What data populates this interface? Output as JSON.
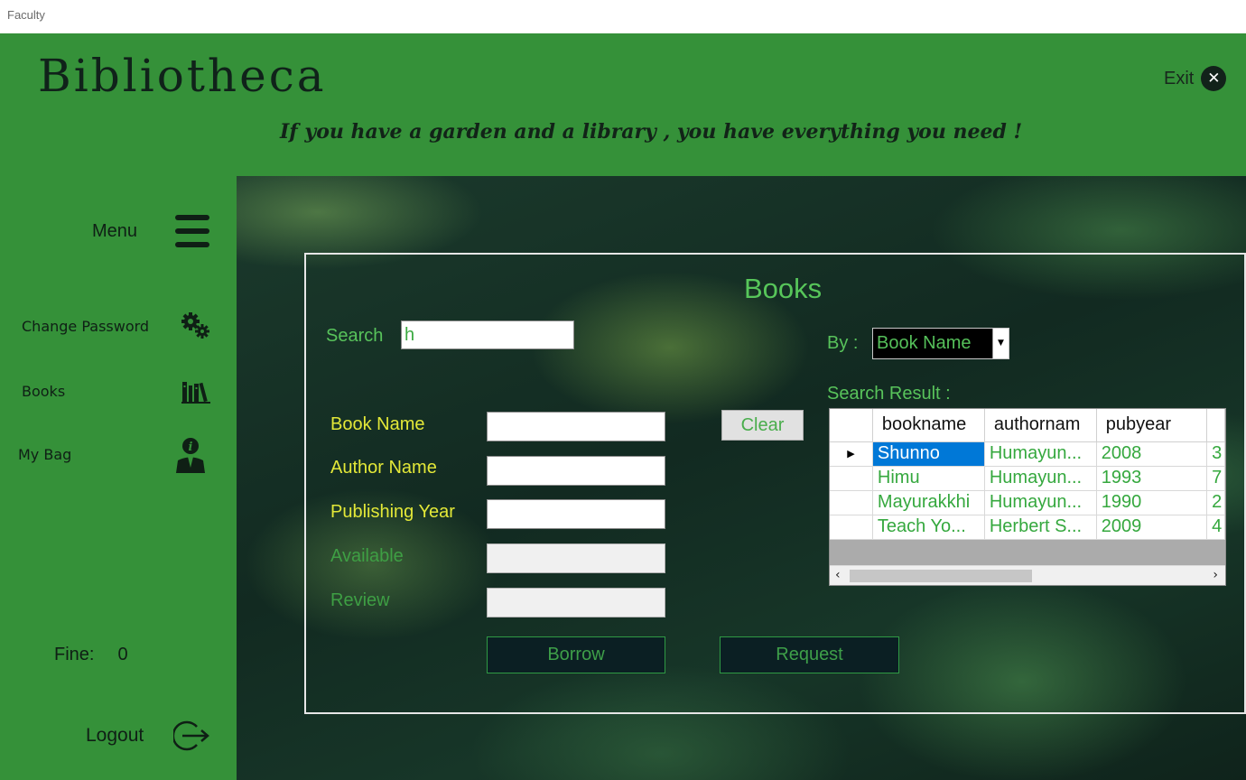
{
  "window": {
    "title": "Faculty"
  },
  "header": {
    "brand": "Bibliotheca",
    "tagline": "If you have a garden and a library , you have everything you need !",
    "exit_label": "Exit"
  },
  "sidebar": {
    "menu_label": "Menu",
    "items": [
      {
        "label": "Change Password",
        "icon": "gears-icon"
      },
      {
        "label": "Books",
        "icon": "books-icon"
      },
      {
        "label": "My Bag",
        "icon": "user-info-icon"
      }
    ],
    "fine_label": "Fine:",
    "fine_value": "0",
    "logout_label": "Logout"
  },
  "books": {
    "title": "Books",
    "search_label": "Search",
    "search_value": "h",
    "by_label": "By :",
    "by_selected": "Book Name",
    "search_result_label": "Search Result :",
    "fields": {
      "book_name": "Book Name",
      "author_name": "Author Name",
      "publishing_year": "Publishing Year",
      "available": "Available",
      "review": "Review"
    },
    "clear_label": "Clear",
    "borrow_label": "Borrow",
    "request_label": "Request",
    "results": {
      "columns": [
        "bookname",
        "authornam",
        "pubyear"
      ],
      "rows": [
        [
          "Shunno",
          "Humayun...",
          "2008",
          "3"
        ],
        [
          "Himu",
          "Humayun...",
          "1993",
          "7"
        ],
        [
          "Mayurakkhi",
          "Humayun...",
          "1990",
          "2"
        ],
        [
          "Teach Yo...",
          "Herbert S...",
          "2009",
          "4"
        ]
      ],
      "selected_row": 0
    }
  },
  "colors": {
    "header_green": "#359139",
    "label_green": "#58c35b",
    "label_yellow": "#e3e838",
    "selection_blue": "#0078d7"
  }
}
